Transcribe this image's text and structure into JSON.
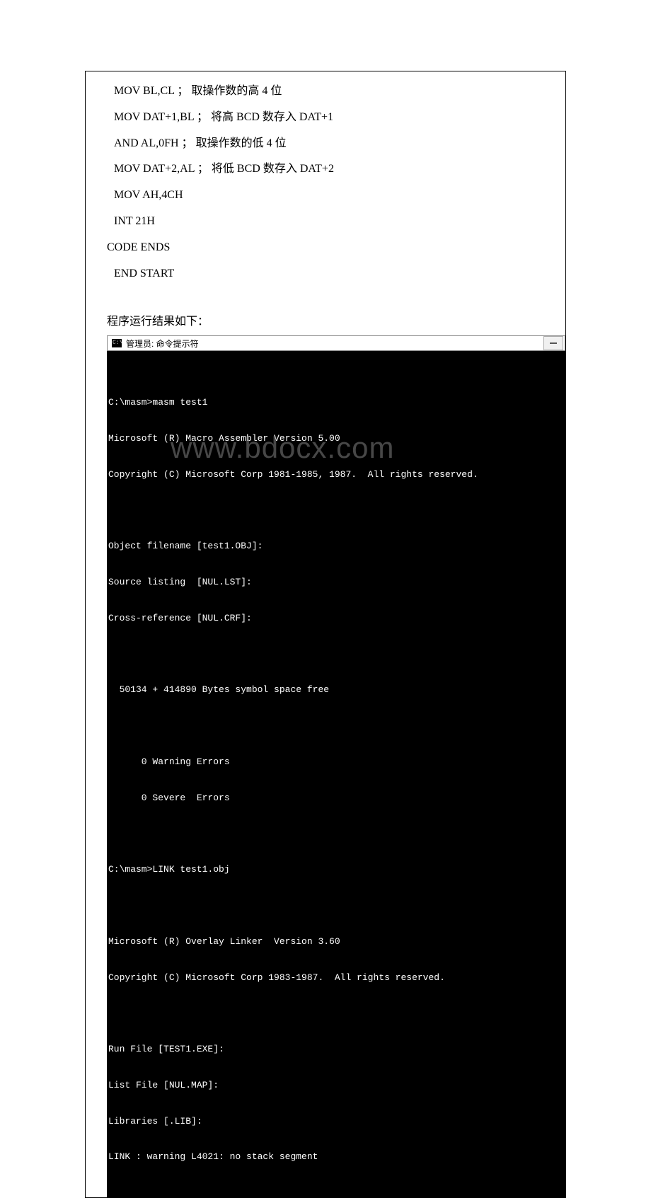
{
  "code": {
    "line1": "MOV BL,CL ； 取操作数的高 4 位",
    "line2": "MOV DAT+1,BL ； 将高 BCD 数存入 DAT+1",
    "line3": "AND AL,0FH ； 取操作数的低 4 位",
    "line4": "MOV DAT+2,AL ； 将低 BCD 数存入 DAT+2",
    "line5": "MOV AH,4CH",
    "line6": "INT 21H",
    "line7": "CODE ENDS",
    "line8": "END START"
  },
  "result_label": "程序运行结果如下：",
  "terminal": {
    "icon_text": "C:\\",
    "title": "管理员: 命令提示符",
    "lines": {
      "l1": "C:\\masm>masm test1",
      "l2": "Microsoft (R) Macro Assembler Version 5.00",
      "l3": "Copyright (C) Microsoft Corp 1981-1985, 1987.  All rights reserved.",
      "l4": "",
      "l5": "Object filename [test1.OBJ]:",
      "l6": "Source listing  [NUL.LST]:",
      "l7": "Cross-reference [NUL.CRF]:",
      "l8": "",
      "l9": "  50134 + 414890 Bytes symbol space free",
      "l10": "",
      "l11": "      0 Warning Errors",
      "l12": "      0 Severe  Errors",
      "l13": "",
      "l14": "C:\\masm>LINK test1.obj",
      "l15": "",
      "l16": "Microsoft (R) Overlay Linker  Version 3.60",
      "l17": "Copyright (C) Microsoft Corp 1983-1987.  All rights reserved.",
      "l18": "",
      "l19": "Run File [TEST1.EXE]:",
      "l20": "List File [NUL.MAP]:",
      "l21": "Libraries [.LIB]:",
      "l22": "LINK : warning L4021: no stack segment"
    }
  },
  "watermark": "www.bdocx.com"
}
